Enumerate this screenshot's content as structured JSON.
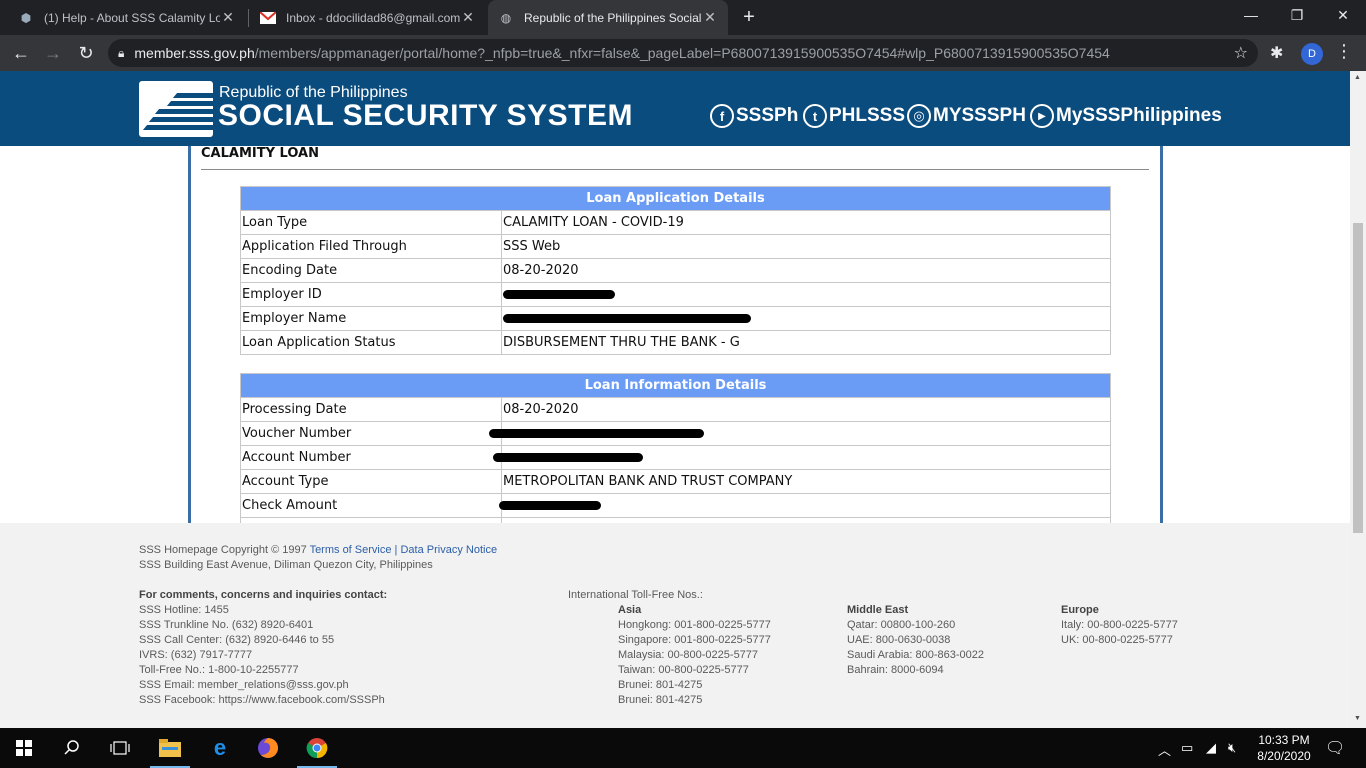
{
  "browser": {
    "tabs": [
      {
        "label": "(1) Help - About SSS Calamity Lo",
        "icon": "cube-icon",
        "active": false
      },
      {
        "label": "Inbox - ddocilidad86@gmail.com",
        "icon": "gmail-icon",
        "active": false
      },
      {
        "label": "Republic of the Philippines Social",
        "icon": "globe-icon",
        "active": true
      }
    ],
    "new_tab": "+",
    "url_host": "member.sss.gov.ph",
    "url_path": "/members/appmanager/portal/home?_nfpb=true&_nfxr=false&_pageLabel=P6800713915900535O7454#wlp_P6800713915900535O7454",
    "profile_initial": "D"
  },
  "header": {
    "subtitle": "Republic of the Philippines",
    "title": "SOCIAL SECURITY SYSTEM",
    "social": [
      {
        "icon": "facebook-icon",
        "glyph": "f",
        "label": "SSSPh"
      },
      {
        "icon": "twitter-icon",
        "glyph": "t",
        "label": "PHLSSS"
      },
      {
        "icon": "instagram-icon",
        "glyph": "◎",
        "label": "MYSSSPH"
      },
      {
        "icon": "youtube-icon",
        "glyph": "▶",
        "label": "MySSSPhilippines"
      }
    ]
  },
  "page": {
    "section_title": "CALAMITY LOAN",
    "application": {
      "heading": "Loan Application Details",
      "rows": [
        {
          "label": "Loan Type",
          "value": "CALAMITY LOAN - COVID-19"
        },
        {
          "label": "Application Filed Through",
          "value": "SSS Web"
        },
        {
          "label": "Encoding Date",
          "value": "08-20-2020"
        },
        {
          "label": "Employer ID",
          "value": ""
        },
        {
          "label": "Employer Name",
          "value": ""
        },
        {
          "label": "Loan Application Status",
          "value": "DISBURSEMENT THRU THE BANK - G"
        }
      ]
    },
    "information": {
      "heading": "Loan Information Details",
      "rows": [
        {
          "label": "Processing Date",
          "value": "08-20-2020"
        },
        {
          "label": "Voucher Number",
          "value": ""
        },
        {
          "label": "Account Number",
          "value": ""
        },
        {
          "label": "Account Type",
          "value": "METROPOLITAN BANK AND TRUST COMPANY"
        },
        {
          "label": "Check Amount",
          "value": ""
        }
      ]
    }
  },
  "footer": {
    "copyright": "SSS Homepage Copyright © 1997",
    "terms": "Terms of Service",
    "separator": "|",
    "privacy": "Data Privacy Notice",
    "address": "SSS Building East Avenue, Diliman Quezon City, Philippines",
    "contact_heading": "For comments, concerns and inquiries contact:",
    "contacts": [
      "SSS Hotline: 1455",
      "SSS Trunkline No. (632) 8920-6401",
      "SSS Call Center: (632) 8920-6446 to 55",
      "IVRS: (632) 7917-7777",
      "Toll-Free No.: 1-800-10-2255777",
      "SSS Email: member_relations@sss.gov.ph",
      "SSS Facebook: https://www.facebook.com/SSSPh"
    ],
    "intl_heading": "International Toll-Free Nos.:",
    "asia_heading": "Asia",
    "asia": [
      "Hongkong: 001-800-0225-5777",
      "Singapore: 001-800-0225-5777",
      "Malaysia: 00-800-0225-5777",
      "Taiwan: 00-800-0225-5777",
      "Brunei: 801-4275",
      "Brunei: 801-4275"
    ],
    "me_heading": "Middle East",
    "middle_east": [
      "Qatar: 00800-100-260",
      "UAE: 800-0630-0038",
      "Saudi Arabia: 800-863-0022",
      "Bahrain: 8000-6094"
    ],
    "eu_heading": "Europe",
    "europe": [
      "Italy: 00-800-0225-5777",
      "UK: 00-800-0225-5777"
    ]
  },
  "taskbar": {
    "time": "10:33 PM",
    "date": "8/20/2020"
  }
}
